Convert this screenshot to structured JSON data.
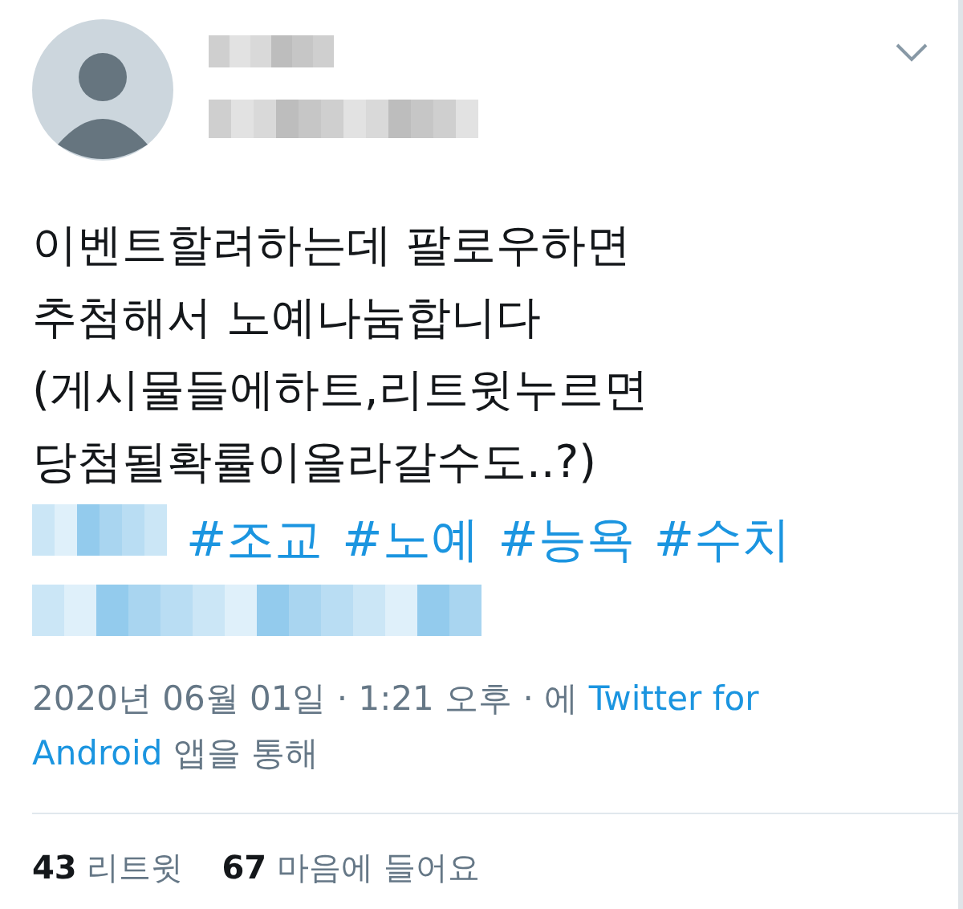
{
  "tweet": {
    "text_lines": [
      "이벤트할려하는데 팔로우하면",
      "추첨해서 노예나눔합니다",
      "(게시물들에하트,리트윗누르면",
      "당첨될확률이올라갈수도..?)"
    ],
    "hashtags": [
      "#조교",
      "#노예",
      "#능욕",
      "#수치"
    ],
    "meta_lines": [
      [
        {
          "kind": "text",
          "text": "2020년 06월 01일 · 1:21 오후 · 에 "
        },
        {
          "kind": "link",
          "text": "Twitter for"
        }
      ],
      [
        {
          "kind": "link",
          "text": "Android"
        },
        {
          "kind": "text",
          "text": " 앱을 통해"
        }
      ]
    ],
    "stats": [
      {
        "count": "43",
        "label": "리트윗"
      },
      {
        "count": "67",
        "label": "마음에 들어요"
      }
    ]
  }
}
